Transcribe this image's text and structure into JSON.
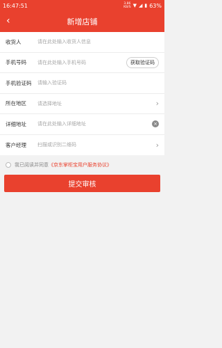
{
  "status": {
    "time": "16:47:51",
    "speed_value": "3.86",
    "speed_unit": "KB/S",
    "battery": "63%"
  },
  "nav": {
    "back": "‹",
    "title": "新增店铺"
  },
  "form": {
    "receiver_label": "收货人",
    "receiver_placeholder": "请在此处输入收货人信息",
    "phone_label": "手机号码",
    "phone_placeholder": "请在此处输入手机号码",
    "code_button": "获取验证码",
    "code_label": "手机验证码",
    "code_placeholder": "请输入验证码",
    "region_label": "所在地区",
    "region_placeholder": "请选择地址",
    "address_label": "详细地址",
    "address_placeholder": "请在此处输入详细地址",
    "manager_label": "客户经理",
    "manager_placeholder": "扫描或识别二维码"
  },
  "agreement": {
    "prefix": "我已阅读并同意",
    "link": "《京东掌柜宝用户服务协议》"
  },
  "submit": {
    "label": "提交审核"
  },
  "colors": {
    "primary": "#e9412e",
    "background": "#f2f2f2"
  },
  "icons": [
    "back-arrow",
    "chevron-right",
    "clear",
    "wifi",
    "signal",
    "battery"
  ]
}
